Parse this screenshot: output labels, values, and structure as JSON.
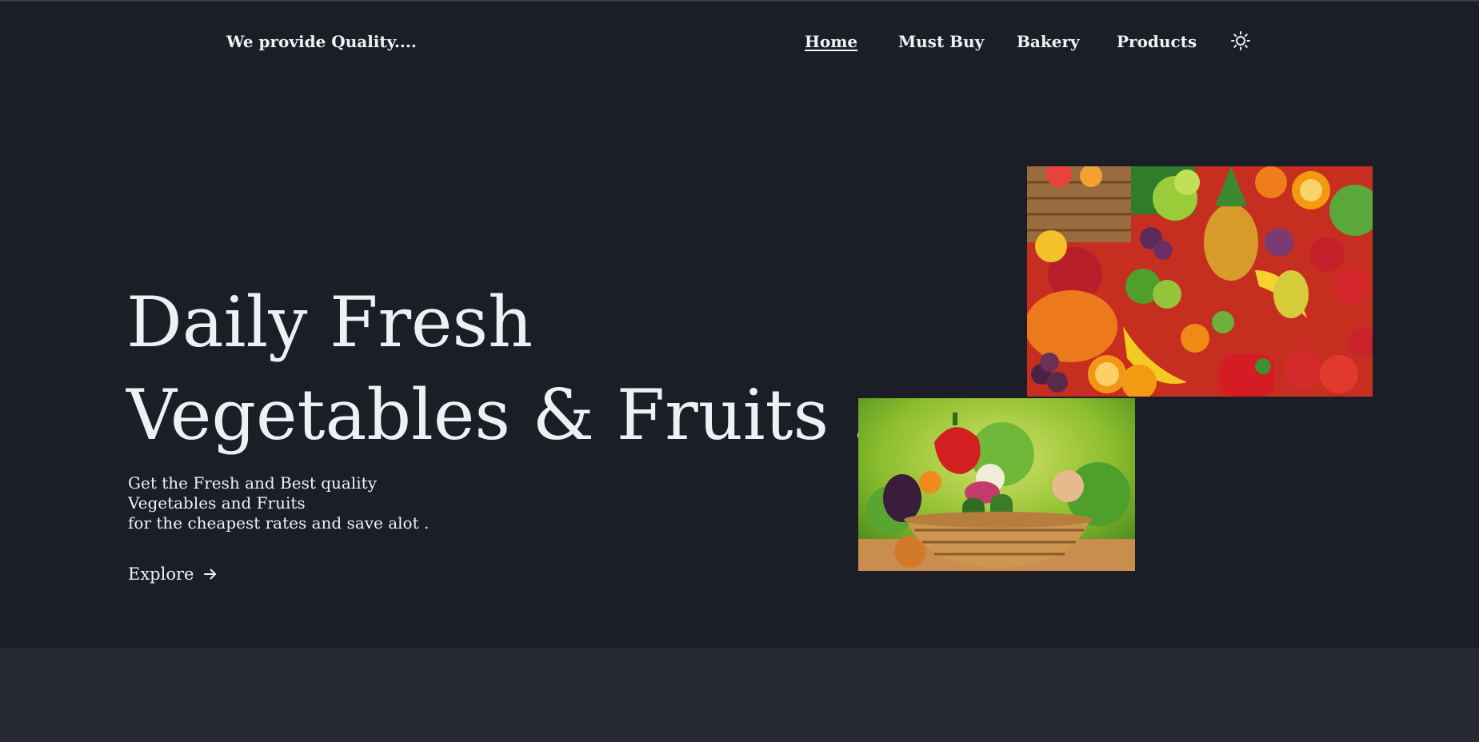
{
  "header": {
    "brand": "We provide Quality....",
    "nav": [
      {
        "label": "Home",
        "active": true
      },
      {
        "label": "Must Buy",
        "active": false
      },
      {
        "label": "Bakery",
        "active": false
      },
      {
        "label": "Products",
        "active": false
      }
    ],
    "theme_icon": "sun-icon"
  },
  "hero": {
    "title_line1": "Daily Fresh",
    "title_line2": "Vegetables & Fruits ...",
    "subtitle": [
      "Get the Fresh and Best quality",
      "Vegetables and Fruits",
      "for the cheapest rates and save alot ."
    ],
    "cta_label": "Explore",
    "cta_icon": "arrow-right-icon"
  },
  "images": {
    "fruits_collage": "mixed-fruits-vegetables-image",
    "veg_basket": "vegetable-basket-image"
  },
  "colors": {
    "background": "#1b1e26",
    "footer_band": "#252933",
    "text": "#f1f2f4"
  }
}
